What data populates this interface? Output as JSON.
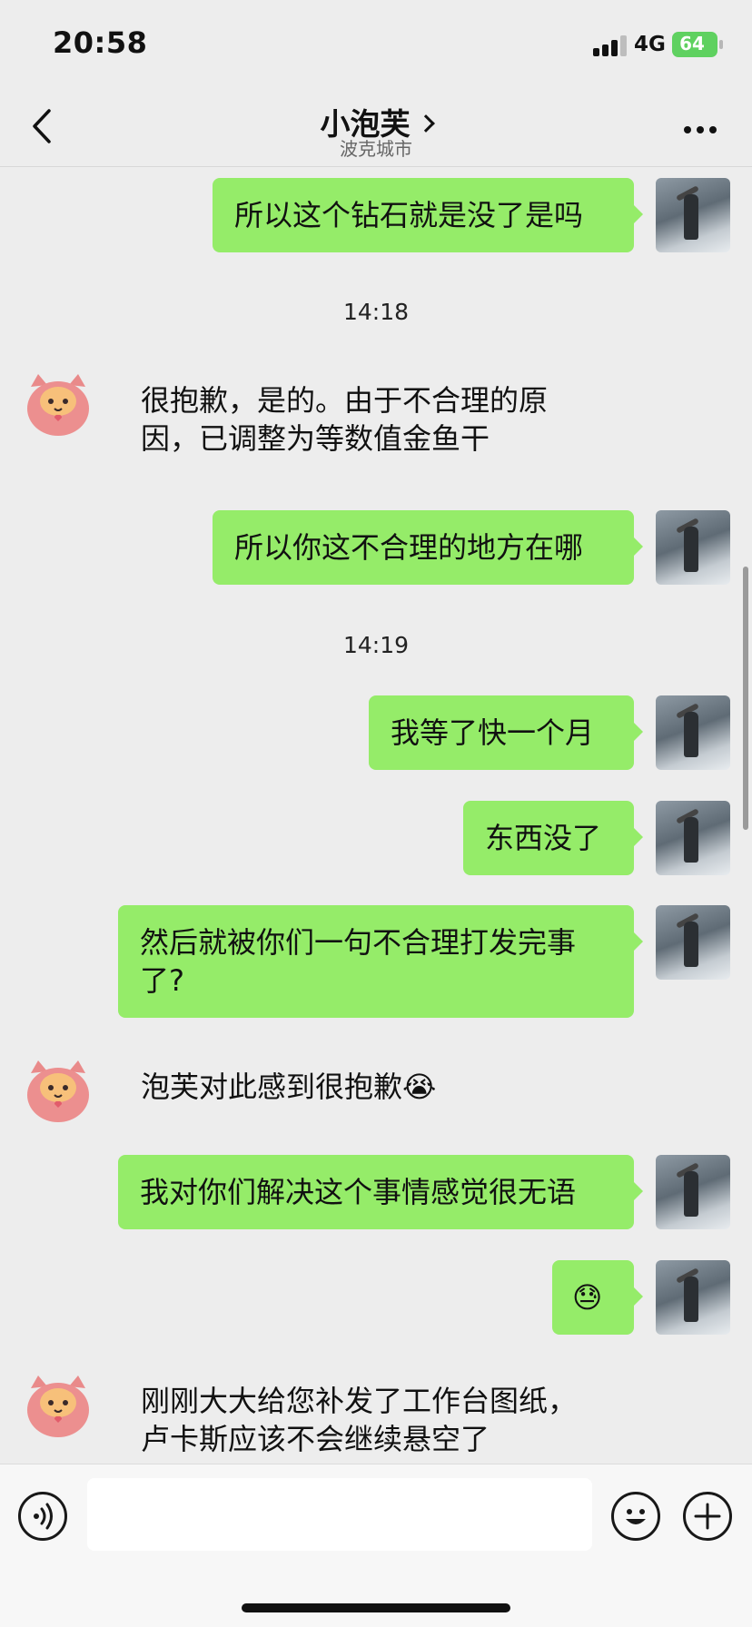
{
  "status_bar": {
    "time": "20:58",
    "network": "4G",
    "battery": "64"
  },
  "header": {
    "title": "小泡芙",
    "subtitle": "波克城市",
    "back_icon": "chevron-left-icon",
    "more_icon": "ellipsis-icon"
  },
  "messages": [
    {
      "side": "right",
      "text": "所以这个钻石就是没了是吗"
    },
    {
      "type": "time",
      "text": "14:18"
    },
    {
      "side": "left",
      "text": "很抱歉，是的。由于不合理的原\n因，已调整为等数值金鱼干"
    },
    {
      "side": "right",
      "text": "所以你这不合理的地方在哪"
    },
    {
      "type": "time",
      "text": "14:19"
    },
    {
      "side": "right",
      "text": "我等了快一个月"
    },
    {
      "side": "right",
      "text": "东西没了"
    },
    {
      "side": "right",
      "text": "然后就被你们一句不合理打发完事\n了?"
    },
    {
      "side": "left",
      "text": "泡芙对此感到很抱歉😭"
    },
    {
      "side": "right",
      "text": "我对你们解决这个事情感觉很无语"
    },
    {
      "side": "right",
      "text": "😓"
    },
    {
      "side": "left",
      "text": "刚刚大大给您补发了工作台图纸，\n卢卡斯应该不会继续悬空了"
    }
  ],
  "input": {
    "placeholder": "",
    "voice_icon": "voice-icon",
    "emoji_icon": "smiley-icon",
    "add_icon": "plus-icon"
  },
  "colors": {
    "bubble_right": "#95ec69",
    "background": "#ededed",
    "battery_green": "#5fd160"
  }
}
